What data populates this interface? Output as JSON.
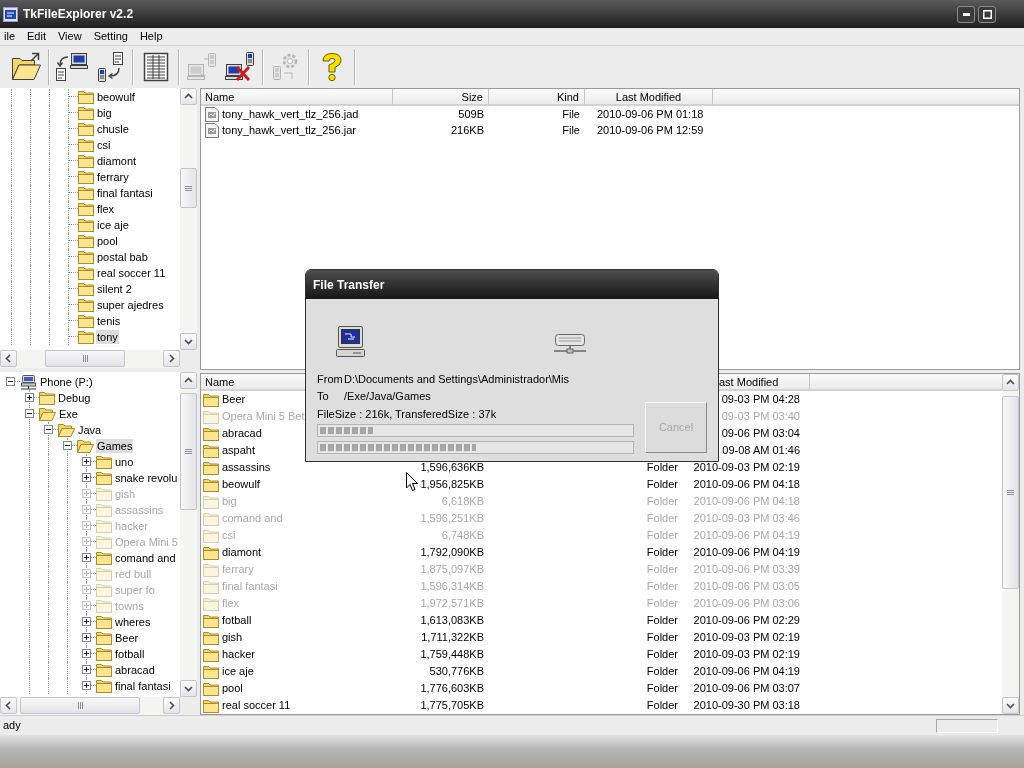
{
  "window": {
    "title": "TkFileExplorer v2.2"
  },
  "menu": [
    "ile",
    "Edit",
    "View",
    "Setting",
    "Help"
  ],
  "toolbar": [
    {
      "kind": "open",
      "disabled": false
    },
    {
      "kind": "separator"
    },
    {
      "kind": "upload",
      "disabled": false
    },
    {
      "kind": "download",
      "disabled": false
    },
    {
      "kind": "separator"
    },
    {
      "kind": "view",
      "disabled": false
    },
    {
      "kind": "separator"
    },
    {
      "kind": "sync",
      "disabled": true
    },
    {
      "kind": "disconnect",
      "disabled": false
    },
    {
      "kind": "separator"
    },
    {
      "kind": "settings",
      "disabled": true
    },
    {
      "kind": "separator"
    },
    {
      "kind": "help",
      "disabled": false
    },
    {
      "kind": "separator"
    }
  ],
  "local_tree": {
    "items": [
      {
        "label": "beowulf",
        "selected": false
      },
      {
        "label": "big",
        "selected": false
      },
      {
        "label": "chusle",
        "selected": false
      },
      {
        "label": "csi",
        "selected": false
      },
      {
        "label": "diamont",
        "selected": false
      },
      {
        "label": "ferrary",
        "selected": false
      },
      {
        "label": "final fantasi",
        "selected": false
      },
      {
        "label": "flex",
        "selected": false
      },
      {
        "label": "ice aje",
        "selected": false
      },
      {
        "label": "pool",
        "selected": false
      },
      {
        "label": "postal bab",
        "selected": false
      },
      {
        "label": "real soccer 11",
        "selected": false
      },
      {
        "label": "silent 2",
        "selected": false
      },
      {
        "label": "super ajedres",
        "selected": false
      },
      {
        "label": "tenis",
        "selected": false
      },
      {
        "label": "tony",
        "selected": true
      }
    ]
  },
  "phone_tree": {
    "items": [
      {
        "label": "Phone (P:)",
        "kind": "drive",
        "expanded": true,
        "selected": false,
        "children": [
          {
            "label": "Debug",
            "kind": "folder",
            "expanded": false,
            "selected": false
          },
          {
            "label": "Exe",
            "kind": "folder",
            "expanded": true,
            "selected": false,
            "children": [
              {
                "label": "Java",
                "kind": "folder",
                "expanded": true,
                "selected": false,
                "children": [
                  {
                    "label": "Games",
                    "kind": "folder",
                    "expanded": true,
                    "selected": true,
                    "children": [
                      {
                        "label": "uno",
                        "kind": "folder",
                        "expanded": false,
                        "selected": false,
                        "dimmed": false
                      },
                      {
                        "label": "snake revolu",
                        "kind": "folder",
                        "expanded": false,
                        "selected": false,
                        "dimmed": false
                      },
                      {
                        "label": "gish",
                        "kind": "folder",
                        "expanded": false,
                        "selected": false,
                        "dimmed": true
                      },
                      {
                        "label": "assassins",
                        "kind": "folder",
                        "expanded": false,
                        "selected": false,
                        "dimmed": true
                      },
                      {
                        "label": "hacker",
                        "kind": "folder",
                        "expanded": false,
                        "selected": false,
                        "dimmed": true
                      },
                      {
                        "label": "Opera Mini 5",
                        "kind": "folder",
                        "expanded": false,
                        "selected": false,
                        "dimmed": true
                      },
                      {
                        "label": "comand and",
                        "kind": "folder",
                        "expanded": false,
                        "selected": false,
                        "dimmed": false
                      },
                      {
                        "label": "red bull",
                        "kind": "folder",
                        "expanded": false,
                        "selected": false,
                        "dimmed": true
                      },
                      {
                        "label": "super fo",
                        "kind": "folder",
                        "expanded": false,
                        "selected": false,
                        "dimmed": true
                      },
                      {
                        "label": "towns",
                        "kind": "folder",
                        "expanded": false,
                        "selected": false,
                        "dimmed": true
                      },
                      {
                        "label": "wheres",
                        "kind": "folder",
                        "expanded": false,
                        "selected": false,
                        "dimmed": false
                      },
                      {
                        "label": "Beer",
                        "kind": "folder",
                        "expanded": false,
                        "selected": false,
                        "dimmed": false
                      },
                      {
                        "label": "fotball",
                        "kind": "folder",
                        "expanded": false,
                        "selected": false,
                        "dimmed": false
                      },
                      {
                        "label": "abracad",
                        "kind": "folder",
                        "expanded": false,
                        "selected": false,
                        "dimmed": false
                      },
                      {
                        "label": "final fantasi",
                        "kind": "folder",
                        "expanded": false,
                        "selected": false,
                        "dimmed": false
                      }
                    ]
                  }
                ]
              }
            ]
          }
        ]
      }
    ]
  },
  "file_list": {
    "columns": [
      "Name",
      "Size",
      "Kind",
      "Last Modified"
    ],
    "rows": [
      {
        "name": "tony_hawk_vert_tlz_256.jad",
        "size": "509B",
        "file_kind": "File",
        "modified": "2010-09-06 PM 01:18"
      },
      {
        "name": "tony_hawk_vert_tlz_256.jar",
        "size": "216KB",
        "file_kind": "File",
        "modified": "2010-09-06 PM 12:59"
      }
    ]
  },
  "folder_list": {
    "header": {
      "name": "Name",
      "modified": "ast Modified"
    },
    "rows": [
      {
        "name": "Beer",
        "modified": "09-03 PM 04:28",
        "dimmed": false
      },
      {
        "name": "Opera Mini 5 Bet",
        "modified": "09-03 PM 03:40",
        "dimmed": true
      },
      {
        "name": "abracad",
        "modified": "09-06 PM 03:04",
        "dimmed": false
      },
      {
        "name": "aspaht",
        "modified": "09-08 AM 01:46",
        "dimmed": false
      },
      {
        "name": "assassins",
        "size": "1,596,636KB",
        "file_kind": "Folder",
        "modified": "2010-09-03 PM 02:19",
        "dimmed": false
      },
      {
        "name": "beowulf",
        "size": "1,956,825KB",
        "file_kind": "Folder",
        "modified": "2010-09-06 PM 04:18",
        "dimmed": false
      },
      {
        "name": "big",
        "size": "6,618KB",
        "file_kind": "Folder",
        "modified": "2010-09-06 PM 04:18",
        "dimmed": true
      },
      {
        "name": "comand and",
        "size": "1,596,251KB",
        "file_kind": "Folder",
        "modified": "2010-09-03 PM 03:46",
        "dimmed": true
      },
      {
        "name": "csi",
        "size": "6,748KB",
        "file_kind": "Folder",
        "modified": "2010-09-06 PM 04:19",
        "dimmed": true
      },
      {
        "name": "diamont",
        "size": "1,792,090KB",
        "file_kind": "Folder",
        "modified": "2010-09-06 PM 04:19",
        "dimmed": false
      },
      {
        "name": "ferrary",
        "size": "1,875,097KB",
        "file_kind": "Folder",
        "modified": "2010-09-06 PM 03:39",
        "dimmed": true
      },
      {
        "name": "final fantasi",
        "size": "1,596,314KB",
        "file_kind": "Folder",
        "modified": "2010-09-06 PM 03:05",
        "dimmed": true
      },
      {
        "name": "flex",
        "size": "1,972,571KB",
        "file_kind": "Folder",
        "modified": "2010-09-06 PM 03:06",
        "dimmed": true
      },
      {
        "name": "fotball",
        "size": "1,613,083KB",
        "file_kind": "Folder",
        "modified": "2010-09-06 PM 02:29",
        "dimmed": false
      },
      {
        "name": "gish",
        "size": "1,711,322KB",
        "file_kind": "Folder",
        "modified": "2010-09-03 PM 02:19",
        "dimmed": false
      },
      {
        "name": "hacker",
        "size": "1,759,448KB",
        "file_kind": "Folder",
        "modified": "2010-09-03 PM 02:19",
        "dimmed": false
      },
      {
        "name": "ice aje",
        "size": "530,776KB",
        "file_kind": "Folder",
        "modified": "2010-09-06 PM 04:19",
        "dimmed": false
      },
      {
        "name": "pool",
        "size": "1,776,603KB",
        "file_kind": "Folder",
        "modified": "2010-09-06 PM 03:07",
        "dimmed": false
      },
      {
        "name": "real soccer 11",
        "size": "1,775,705KB",
        "file_kind": "Folder",
        "modified": "2010-09-30 PM 03:18",
        "dimmed": false
      }
    ]
  },
  "dialog": {
    "title": "File Transfer",
    "from_label": "From",
    "from": "D:\\Documents and Settings\\Administrador\\Mis",
    "to_label": "To",
    "to": "/Exe/Java/Games",
    "status": "FileSize : 216k, TransferedSize : 37k",
    "progress": [
      {
        "level": 0.17
      },
      {
        "level": 0.5
      }
    ],
    "cancel": {
      "label": "Cancel",
      "disabled": true
    }
  },
  "status_bar": {
    "text": "ady"
  }
}
